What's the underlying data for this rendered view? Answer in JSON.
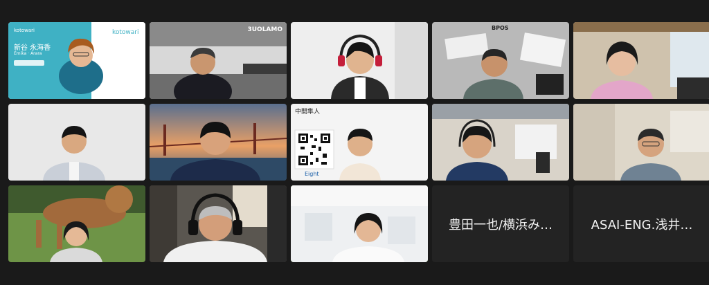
{
  "participants": [
    {
      "id": "p1",
      "background_brand": "kotowari",
      "background_text": "新谷 永海香",
      "background_subtext": "Emika · Arara",
      "background_tag": "kotowari"
    },
    {
      "id": "p2",
      "background_brand": "3UOLAMO",
      "background_text": ""
    },
    {
      "id": "p3"
    },
    {
      "id": "p4",
      "background_brand": "BPOS"
    },
    {
      "id": "p5"
    },
    {
      "id": "p6"
    },
    {
      "id": "p7"
    },
    {
      "id": "p8",
      "background_text": "中間隼人",
      "background_brand": "Eight"
    },
    {
      "id": "p9"
    },
    {
      "id": "p10"
    },
    {
      "id": "p11"
    },
    {
      "id": "p12"
    },
    {
      "id": "p13",
      "active_speaker": true
    },
    {
      "id": "p14",
      "display_name": "豊田一也/横浜み…"
    },
    {
      "id": "p15",
      "display_name": "ASAI-ENG.浅井…"
    }
  ],
  "colors": {
    "background": "#1a1a1a",
    "active_speaker_border": "#8fd14f",
    "name_tile": "#232323",
    "kotowari_teal": "#3fb1c4"
  }
}
